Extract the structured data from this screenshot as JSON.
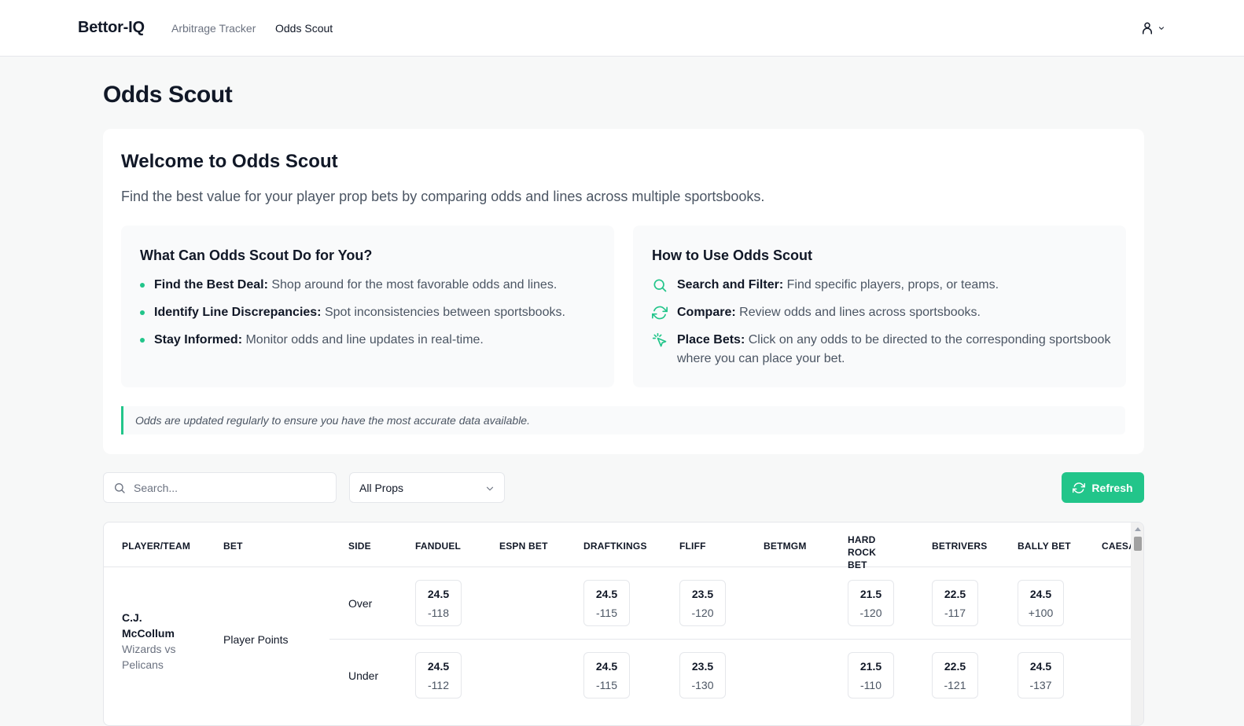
{
  "nav": {
    "brand": "Bettor-IQ",
    "links": [
      "Arbitrage Tracker",
      "Odds Scout"
    ],
    "active": "Odds Scout"
  },
  "page_title": "Odds Scout",
  "welcome": {
    "title": "Welcome to Odds Scout",
    "subtitle": "Find the best value for your player prop bets by comparing odds and lines across multiple sportsbooks.",
    "features": {
      "title": "What Can Odds Scout Do for You?",
      "items": [
        {
          "label": "Find the Best Deal:",
          "text": "Shop around for the most favorable odds and lines."
        },
        {
          "label": "Identify Line Discrepancies:",
          "text": "Spot inconsistencies between sportsbooks."
        },
        {
          "label": "Stay Informed:",
          "text": "Monitor odds and line updates in real-time."
        }
      ]
    },
    "howto": {
      "title": "How to Use Odds Scout",
      "items": [
        {
          "icon": "search-icon",
          "label": "Search and Filter:",
          "text": "Find specific players, props, or teams."
        },
        {
          "icon": "refresh-icon",
          "label": "Compare:",
          "text": "Review odds and lines across sportsbooks."
        },
        {
          "icon": "cursor-click-icon",
          "label": "Place Bets:",
          "text": "Click on any odds to be directed to the corresponding sportsbook where you can place your bet."
        }
      ]
    },
    "note": "Odds are updated regularly to ensure you have the most accurate data available."
  },
  "controls": {
    "search_placeholder": "Search...",
    "prop_filter": "All Props",
    "refresh_label": "Refresh"
  },
  "colors": {
    "accent": "#22c58a",
    "text": "#111827",
    "muted": "#4b5563",
    "background": "#f7f8f8"
  },
  "table": {
    "columns": [
      "PLAYER/TEAM",
      "BET",
      "SIDE",
      "FANDUEL",
      "ESPN BET",
      "DRAFTKINGS",
      "FLIFF",
      "BETMGM",
      "HARD ROCK BET",
      "BETRIVERS",
      "BALLY BET",
      "CAESA"
    ],
    "rows": [
      {
        "player": "C.J. McCollum",
        "game": "Wizards vs Pelicans",
        "bet": "Player Points",
        "sides": [
          {
            "side": "Over",
            "odds": {
              "FANDUEL": {
                "line": "24.5",
                "price": "-118"
              },
              "DRAFTKINGS": {
                "line": "24.5",
                "price": "-115"
              },
              "FLIFF": {
                "line": "23.5",
                "price": "-120"
              },
              "HARD ROCK BET": {
                "line": "21.5",
                "price": "-120"
              },
              "BETRIVERS": {
                "line": "22.5",
                "price": "-117"
              },
              "BALLY BET": {
                "line": "24.5",
                "price": "+100"
              }
            }
          },
          {
            "side": "Under",
            "odds": {
              "FANDUEL": {
                "line": "24.5",
                "price": "-112"
              },
              "DRAFTKINGS": {
                "line": "24.5",
                "price": "-115"
              },
              "FLIFF": {
                "line": "23.5",
                "price": "-130"
              },
              "HARD ROCK BET": {
                "line": "21.5",
                "price": "-110"
              },
              "BETRIVERS": {
                "line": "22.5",
                "price": "-121"
              },
              "BALLY BET": {
                "line": "24.5",
                "price": "-137"
              }
            }
          }
        ]
      }
    ]
  }
}
